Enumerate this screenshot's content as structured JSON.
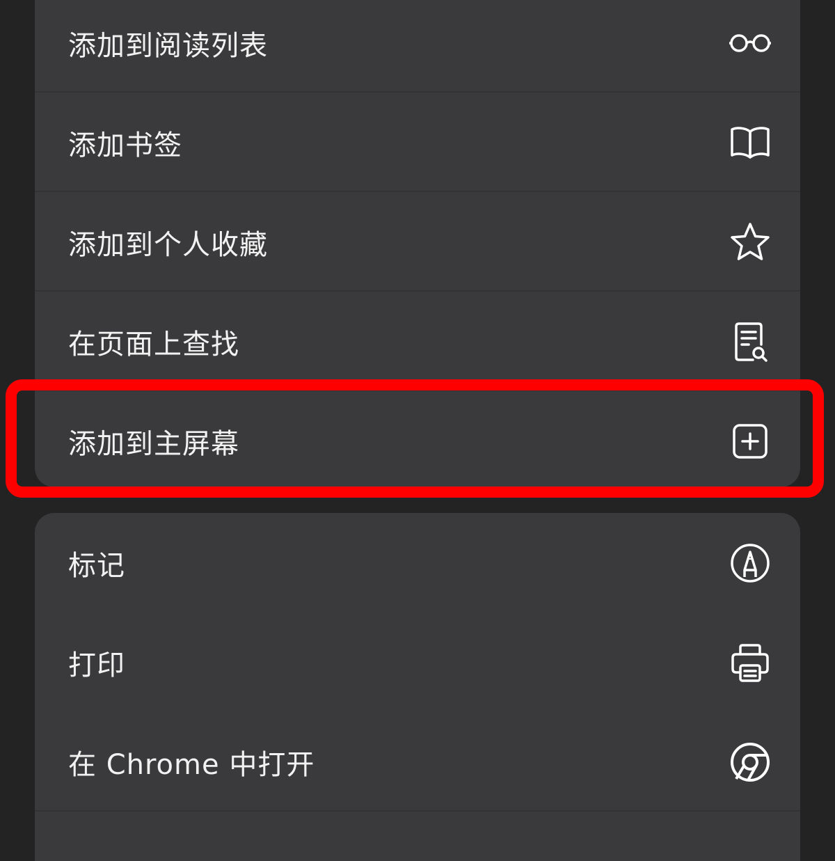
{
  "menu": {
    "group1": [
      {
        "label": "添加到阅读列表",
        "icon": "glasses-icon"
      },
      {
        "label": "添加书签",
        "icon": "book-icon"
      },
      {
        "label": "添加到个人收藏",
        "icon": "star-icon"
      },
      {
        "label": "在页面上查找",
        "icon": "find-in-page-icon"
      },
      {
        "label": "添加到主屏幕",
        "icon": "add-square-icon"
      }
    ],
    "group2": [
      {
        "label": "标记",
        "icon": "markup-pen-icon"
      },
      {
        "label": "打印",
        "icon": "printer-icon"
      },
      {
        "label": "在 Chrome 中打开",
        "icon": "chrome-icon"
      }
    ]
  },
  "colors": {
    "background": "#232323",
    "panel": "#3a3a3c",
    "text": "#f2f2f2",
    "highlight": "#ff0000"
  }
}
